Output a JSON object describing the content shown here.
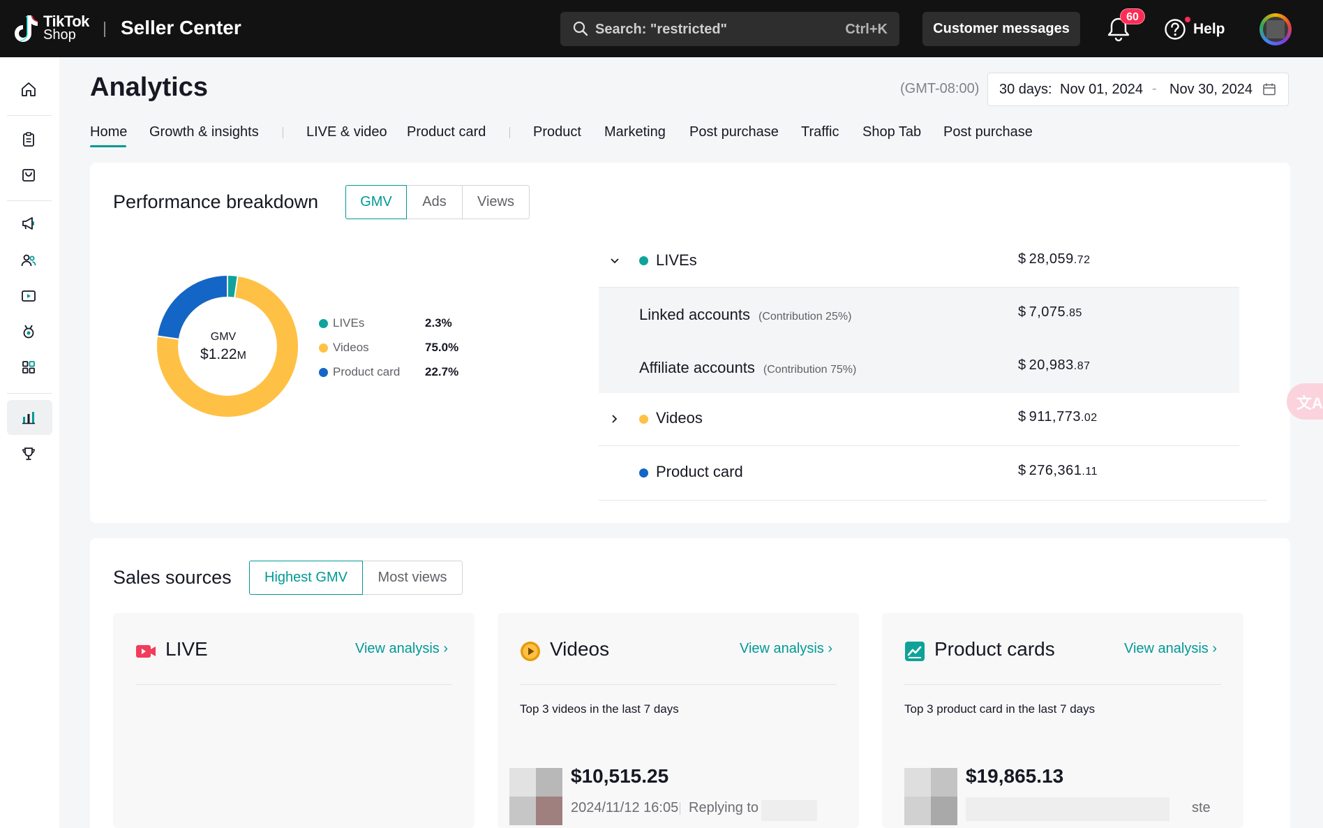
{
  "header": {
    "logo_line1": "TikTok",
    "logo_line2": "Shop",
    "app_title": "Seller Center",
    "search_placeholder": "Search: \"restricted\"",
    "search_shortcut": "Ctrl+K",
    "customer_messages": "Customer messages",
    "notification_count": "60",
    "help_label": "Help"
  },
  "page": {
    "title": "Analytics",
    "timezone": "(GMT-08:00)",
    "date_prefix": "30 days:",
    "date_start": "Nov 01, 2024",
    "date_sep": "-",
    "date_end": "Nov 30, 2024"
  },
  "tabs": [
    "Home",
    "Growth & insights",
    "LIVE & video",
    "Product card",
    "Product",
    "Marketing",
    "Post purchase",
    "Traffic",
    "Shop Tab",
    "Post purchase"
  ],
  "performance": {
    "title": "Performance breakdown",
    "segments": [
      "GMV",
      "Ads",
      "Views"
    ],
    "donut_label": "GMV",
    "donut_value_prefix": "$1.22",
    "donut_value_suffix": "M",
    "legend": [
      {
        "name": "LIVEs",
        "pct": "2.3%",
        "color": "#10a39b"
      },
      {
        "name": "Videos",
        "pct": "75.0%",
        "color": "#ffc145"
      },
      {
        "name": "Product card",
        "pct": "22.7%",
        "color": "#1366c6"
      }
    ],
    "breakdown": {
      "lives": {
        "name": "LIVEs",
        "value_int": "28,059",
        "value_dec": ".72"
      },
      "linked": {
        "name": "Linked accounts",
        "contrib": "(Contribution 25%)",
        "value_int": "7,075",
        "value_dec": ".85"
      },
      "affiliate": {
        "name": "Affiliate accounts",
        "contrib": "(Contribution 75%)",
        "value_int": "20,983",
        "value_dec": ".87"
      },
      "videos": {
        "name": "Videos",
        "value_int": "911,773",
        "value_dec": ".02"
      },
      "product_card": {
        "name": "Product card",
        "value_int": "276,361",
        "value_dec": ".11"
      },
      "currency": "$"
    }
  },
  "sales_sources": {
    "title": "Sales sources",
    "segments": [
      "Highest GMV",
      "Most views"
    ],
    "live": {
      "title": "LIVE",
      "link": "View analysis ›"
    },
    "videos": {
      "title": "Videos",
      "link": "View analysis ›",
      "subtitle": "Top 3 videos in the last 7 days",
      "amount": "$10,515.25",
      "timestamp": "2024/11/12 16:05",
      "reply": "Replying to"
    },
    "product_cards": {
      "title": "Product cards",
      "link": "View analysis ›",
      "subtitle": "Top 3 product card in the last 7 days",
      "amount": "$19,865.13",
      "meta_tail": "ste"
    }
  },
  "colors": {
    "accent": "#009995",
    "lives": "#10a39b",
    "videos": "#ffc145",
    "product_card": "#1366c6",
    "live_icon": "#f23c5b"
  }
}
